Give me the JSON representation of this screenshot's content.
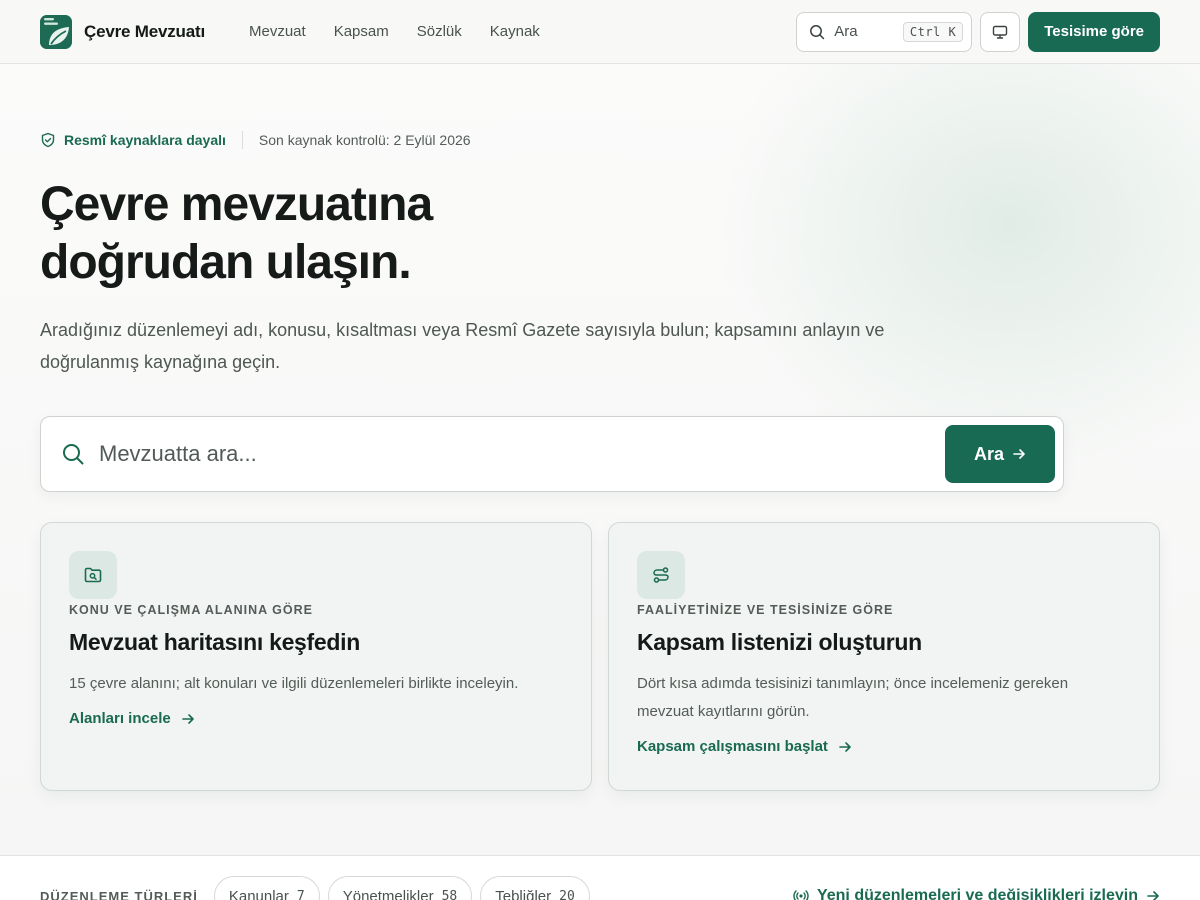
{
  "header": {
    "brand": "Çevre Mevzuatı",
    "nav": [
      {
        "label": "Mevzuat"
      },
      {
        "label": "Kapsam"
      },
      {
        "label": "Sözlük"
      },
      {
        "label": "Kaynak"
      }
    ],
    "search_label": "Ara",
    "search_shortcut": "Ctrl K",
    "display_icon": "monitor-icon",
    "cta": "Tesisime göre"
  },
  "hero": {
    "trust_badge": "Resmî kaynaklara dayalı",
    "last_check": "Son kaynak kontrolü: 2 Eylül 2026",
    "title_line1": "Çevre mevzuatına",
    "title_line2": "doğrudan ulaşın.",
    "subtitle": "Aradığınız düzenlemeyi adı, konusu, kısaltması veya Resmî Gazete sayısıyla bulun; kapsamını anlayın ve doğrulanmış kaynağına geçin.",
    "search_placeholder": "Mevzuatta ara...",
    "search_button": "Ara"
  },
  "cards": [
    {
      "icon": "folder-search-icon",
      "eyebrow": "KONU VE ÇALIŞMA ALANINA GÖRE",
      "title": "Mevzuat haritasını keşfedin",
      "description": "15 çevre alanını; alt konuları ve ilgili düzenlemeleri birlikte inceleyin.",
      "link": "Alanları incele"
    },
    {
      "icon": "route-icon",
      "eyebrow": "FAALİYETİNİZE VE TESİSİNİZE GÖRE",
      "title": "Kapsam listenizi oluşturun",
      "description": "Dört kısa adımda tesisinizi tanımlayın; önce incelemeniz gereken mevzuat kayıtlarını görün.",
      "link": "Kapsam çalışmasını başlat"
    }
  ],
  "bottom": {
    "label": "DÜZENLEME TÜRLERİ",
    "chips": [
      {
        "label": "Kanunlar",
        "count": "7"
      },
      {
        "label": "Yönetmelikler",
        "count": "58"
      },
      {
        "label": "Tebliğler",
        "count": "20"
      }
    ],
    "watch_link": "Yeni düzenlemeleri ve değişiklikleri izleyin"
  },
  "colors": {
    "accent": "#186a53",
    "text": "#161a18",
    "muted": "#545c58",
    "card_bg": "#f1f4f2"
  }
}
